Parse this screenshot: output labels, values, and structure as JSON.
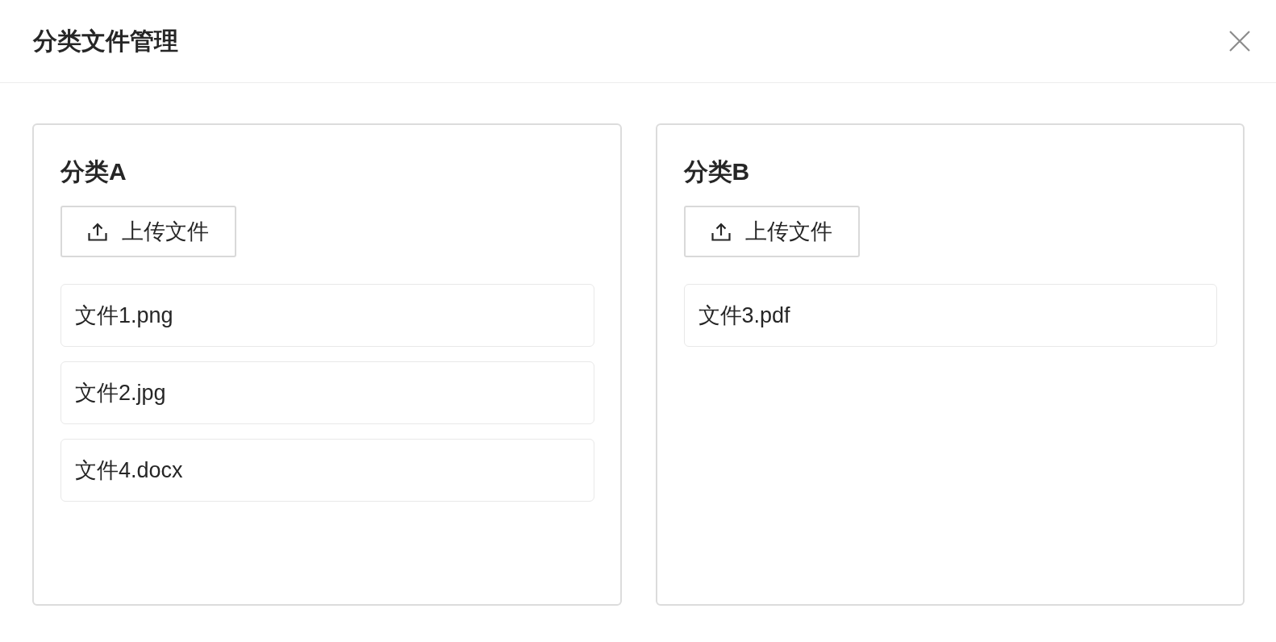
{
  "dialog": {
    "title": "分类文件管理"
  },
  "categories": [
    {
      "title": "分类A",
      "upload_button": "上传文件",
      "files": [
        "文件1.png",
        "文件2.jpg",
        "文件4.docx"
      ]
    },
    {
      "title": "分类B",
      "upload_button": "上传文件",
      "files": [
        "文件3.pdf"
      ]
    }
  ]
}
